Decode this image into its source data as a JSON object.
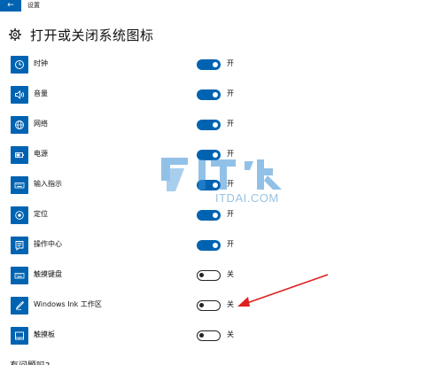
{
  "window": {
    "title": "设置",
    "back_icon": "back-arrow-icon"
  },
  "header": {
    "title": "打开或关闭系统图标",
    "icon": "gear-icon"
  },
  "items": [
    {
      "label": "时钟",
      "icon": "clock-icon",
      "state": "开",
      "on": true
    },
    {
      "label": "音量",
      "icon": "volume-icon",
      "state": "开",
      "on": true
    },
    {
      "label": "网络",
      "icon": "network-globe-icon",
      "state": "开",
      "on": true
    },
    {
      "label": "电源",
      "icon": "battery-icon",
      "state": "开",
      "on": true
    },
    {
      "label": "输入指示",
      "icon": "keyboard-icon",
      "state": "开",
      "on": true
    },
    {
      "label": "定位",
      "icon": "location-icon",
      "state": "开",
      "on": true
    },
    {
      "label": "操作中心",
      "icon": "action-center-icon",
      "state": "开",
      "on": true
    },
    {
      "label": "触摸键盘",
      "icon": "touch-keyboard-icon",
      "state": "关",
      "on": false
    },
    {
      "label": "Windows Ink 工作区",
      "icon": "pen-icon",
      "state": "关",
      "on": false
    },
    {
      "label": "触摸板",
      "icon": "touchpad-icon",
      "state": "关",
      "on": false
    }
  ],
  "footer": {
    "help_text": "有问题吗?"
  },
  "watermark": {
    "text": "ITDAI.COM"
  },
  "colors": {
    "accent": "#0063b1",
    "annotation_arrow": "#e02020"
  }
}
